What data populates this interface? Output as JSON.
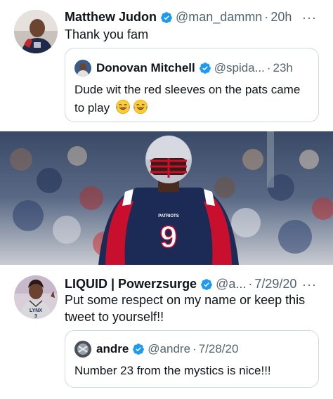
{
  "tweet1": {
    "name": "Matthew Judon",
    "handle": "@man_dammn",
    "separator": "·",
    "time": "20h",
    "more": "···",
    "text": "Thank you fam",
    "quote": {
      "name": "Donovan Mitchell",
      "handle": "@spida...",
      "separator": "·",
      "time": "23h",
      "text": "Dude wit the red sleeves on the pats came to play",
      "emoji": [
        "laughing-tears",
        "laughing-tears"
      ]
    }
  },
  "photo": {
    "jersey_number": "9",
    "jersey_team": "PATRIOTS"
  },
  "tweet2": {
    "name": "LIQUID | Powerzsurge",
    "handle": "@a...",
    "separator": "·",
    "time": "7/29/20",
    "more": "···",
    "text": "Put some respect on my name or keep this tweet to yourself!!",
    "avatar_jersey": "LYNX",
    "avatar_jersey_number": "3",
    "quote": {
      "name": "andre",
      "handle": "@andre",
      "separator": "·",
      "time": "7/28/20",
      "text": "Number 23 from the mystics is nice!!!"
    }
  },
  "colors": {
    "verified": "#1d9bf0",
    "secondary_text": "#536471",
    "border": "#cfd9de"
  }
}
